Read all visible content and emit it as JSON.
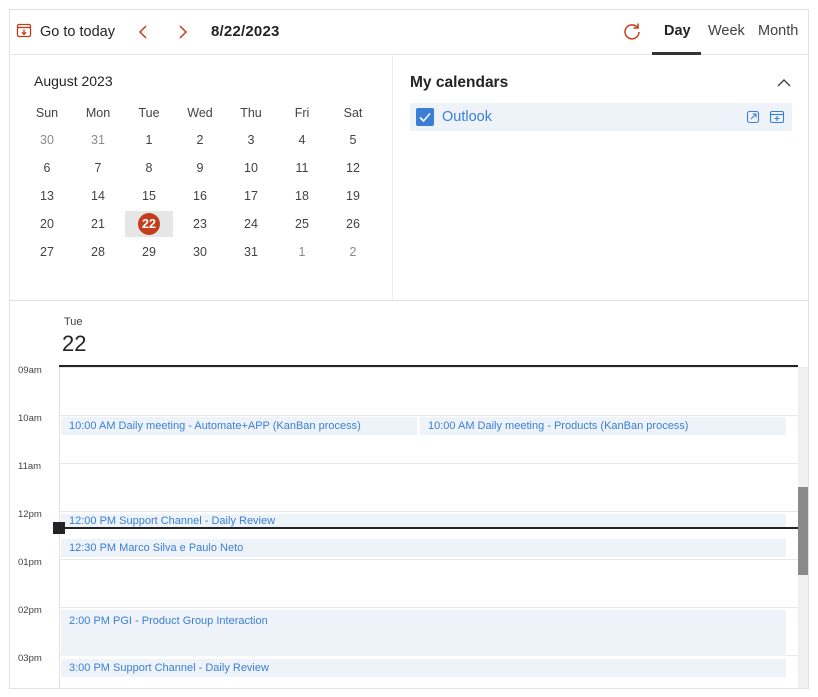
{
  "toolbar": {
    "go_to_today": "Go to today",
    "current_date": "8/22/2023",
    "views": [
      "Day",
      "Week",
      "Month"
    ],
    "active_view": "Day"
  },
  "mini_calendar": {
    "title": "August 2023",
    "weekdays": [
      "Sun",
      "Mon",
      "Tue",
      "Wed",
      "Thu",
      "Fri",
      "Sat"
    ],
    "weeks": [
      [
        "30",
        "31",
        "1",
        "2",
        "3",
        "4",
        "5"
      ],
      [
        "6",
        "7",
        "8",
        "9",
        "10",
        "11",
        "12"
      ],
      [
        "13",
        "14",
        "15",
        "16",
        "17",
        "18",
        "19"
      ],
      [
        "20",
        "21",
        "22",
        "23",
        "24",
        "25",
        "26"
      ],
      [
        "27",
        "28",
        "29",
        "30",
        "31",
        "1",
        "2"
      ]
    ],
    "selected_day": "22"
  },
  "my_calendars": {
    "title": "My calendars",
    "calendars": [
      {
        "name": "Outlook",
        "checked": true
      }
    ]
  },
  "day_view": {
    "weekday": "Tue",
    "date": "22",
    "hours": [
      "09am",
      "10am",
      "11am",
      "12pm",
      "01pm",
      "02pm",
      "03pm"
    ],
    "events": [
      {
        "time": "10:00 AM",
        "title": "Daily meeting - Automate+APP (KanBan process)"
      },
      {
        "time": "10:00 AM",
        "title": "Daily meeting - Products (KanBan process)"
      },
      {
        "time": "12:00 PM",
        "title": "Support Channel - Daily Review"
      },
      {
        "time": "12:30 PM",
        "title": "Marco Silva e Paulo Neto"
      },
      {
        "time": "2:00 PM",
        "title": "PGI - Product Group Interaction"
      },
      {
        "time": "3:00 PM",
        "title": "Support Channel - Daily Review"
      }
    ]
  },
  "colors": {
    "accent": "#3a7fd5",
    "today_badge": "#c43e1c",
    "event_bg": "#eef3fa"
  }
}
